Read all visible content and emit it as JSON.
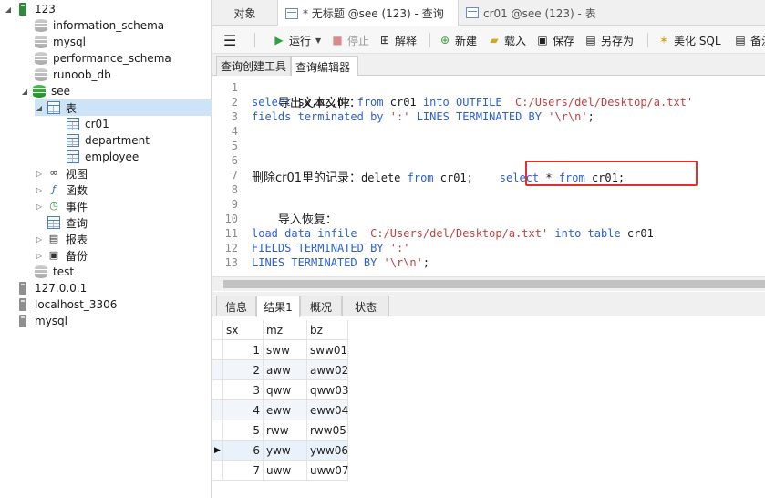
{
  "tree": {
    "items": [
      {
        "label": "123",
        "kind": "connection"
      },
      {
        "label": "information_schema",
        "kind": "database"
      },
      {
        "label": "mysql",
        "kind": "database"
      },
      {
        "label": "performance_schema",
        "kind": "database"
      },
      {
        "label": "runoob_db",
        "kind": "database"
      },
      {
        "label": "see",
        "kind": "database-open"
      },
      {
        "label": "表",
        "kind": "folder-tables"
      },
      {
        "label": "cr01",
        "kind": "table"
      },
      {
        "label": "department",
        "kind": "table"
      },
      {
        "label": "employee",
        "kind": "table"
      },
      {
        "label": "视图",
        "kind": "folder-views"
      },
      {
        "label": "函数",
        "kind": "folder-functions"
      },
      {
        "label": "事件",
        "kind": "folder-events"
      },
      {
        "label": "查询",
        "kind": "folder-queries"
      },
      {
        "label": "报表",
        "kind": "folder-reports"
      },
      {
        "label": "备份",
        "kind": "folder-backups"
      },
      {
        "label": "test",
        "kind": "database"
      },
      {
        "label": "127.0.0.1",
        "kind": "connection-off"
      },
      {
        "label": "localhost_3306",
        "kind": "connection-off"
      },
      {
        "label": "mysql",
        "kind": "connection-off"
      }
    ]
  },
  "tabs": {
    "objects": "对象",
    "query": "* 无标题 @see (123) - 查询",
    "table": "cr01 @see (123) - 表"
  },
  "toolbar": {
    "run": "运行",
    "stop": "停止",
    "explain": "解释",
    "new": "新建",
    "load": "载入",
    "save": "保存",
    "save_as": "另存为",
    "beautify": "美化 SQL",
    "more": "备注"
  },
  "subtabs": {
    "builder": "查询创建工具",
    "editor": "查询编辑器"
  },
  "editor": {
    "line_numbers": [
      "1",
      "2",
      "3",
      "4",
      "5",
      "6",
      "7",
      "8",
      "9",
      "10",
      "11",
      "12",
      "13"
    ],
    "line1": "导出文本文件：",
    "l2": {
      "k1": "select",
      "t1": " sx,mz,bz ",
      "k2": "from",
      "t2": " cr01 ",
      "k3": "into",
      "t3": " ",
      "k4": "OUTFILE",
      "t4": " ",
      "s1": "'C:/Users/del/Desktop/a.txt'"
    },
    "l3": {
      "k1": "fields",
      "t1": " ",
      "k2": "terminated",
      "t2": " ",
      "k3": "by",
      "t3": " ",
      "s1": "':'",
      "t4": " ",
      "k4": "LINES",
      "t5": " ",
      "k5": "TERMINATED",
      "t6": " ",
      "k6": "BY",
      "t7": " ",
      "s2": "'\\r\\n'",
      "t8": ";"
    },
    "l7": {
      "cn": "删除cr01里的记录：",
      "t1": "delete ",
      "k1": "from",
      "t2": " cr01;    ",
      "k2": "select",
      "t3": " * ",
      "k3": "from",
      "t4": " cr01;"
    },
    "line9": "导入恢复：",
    "l11": {
      "k1": "load",
      "t1": " ",
      "k2": "data",
      "t2": " ",
      "k3": "infile",
      "t3": " ",
      "s1": "'C:/Users/del/Desktop/a.txt'",
      "t4": " ",
      "k4": "into",
      "t5": " ",
      "k5": "table",
      "t6": " cr01"
    },
    "l12": {
      "k1": "FIELDS",
      "t1": " ",
      "k2": "TERMINATED",
      "t2": " ",
      "k3": "BY",
      "t3": " ",
      "s1": "':'"
    },
    "l13": {
      "k1": "LINES",
      "t1": " ",
      "k2": "TERMINATED",
      "t2": " ",
      "k3": "BY",
      "t3": " ",
      "s1": "'\\r\\n'",
      "t4": ";"
    }
  },
  "result_tabs": {
    "info": "信息",
    "result1": "结果1",
    "profile": "概况",
    "status": "状态"
  },
  "grid": {
    "columns": [
      "sx",
      "mz",
      "bz"
    ],
    "rows": [
      [
        "1",
        "sww",
        "sww01"
      ],
      [
        "2",
        "aww",
        "aww02"
      ],
      [
        "3",
        "qww",
        "qww03"
      ],
      [
        "4",
        "eww",
        "eww04"
      ],
      [
        "5",
        "rww",
        "rww05"
      ],
      [
        "6",
        "yww",
        "yww06"
      ],
      [
        "7",
        "uww",
        "uww07"
      ]
    ],
    "current_row_marker": "▶"
  },
  "colors": {
    "keyword": "#2a5fd6",
    "string": "#c04040",
    "highlight_box": "#e03030",
    "run_icon": "#2ea43a"
  }
}
